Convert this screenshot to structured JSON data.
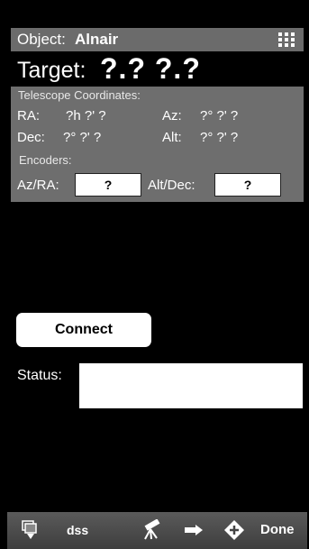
{
  "object": {
    "label": "Object:",
    "name": "Alnair",
    "icon": "grid-menu-icon"
  },
  "target": {
    "label": "Target:",
    "value": "?.? ?.?"
  },
  "telescope": {
    "header": "Telescope Coordinates:",
    "ra_label": "RA:",
    "ra_value": "?h ?' ?",
    "az_label": "Az:",
    "az_value": "?° ?' ?",
    "dec_label": "Dec:",
    "dec_value": "?° ?' ?",
    "alt_label": "Alt:",
    "alt_value": "?° ?' ?"
  },
  "encoders": {
    "header": "Encoders:",
    "azra_label": "Az/RA:",
    "azra_value": "?",
    "altdec_label": "Alt/Dec:",
    "altdec_value": "?"
  },
  "connect": {
    "label": "Connect"
  },
  "status": {
    "label": "Status:",
    "value": ""
  },
  "toolbar": {
    "dss_label": "dss",
    "done_label": "Done",
    "icons": [
      "windows-down-icon",
      "telescope-icon",
      "slew-arrow-icon",
      "add-marker-icon"
    ]
  }
}
